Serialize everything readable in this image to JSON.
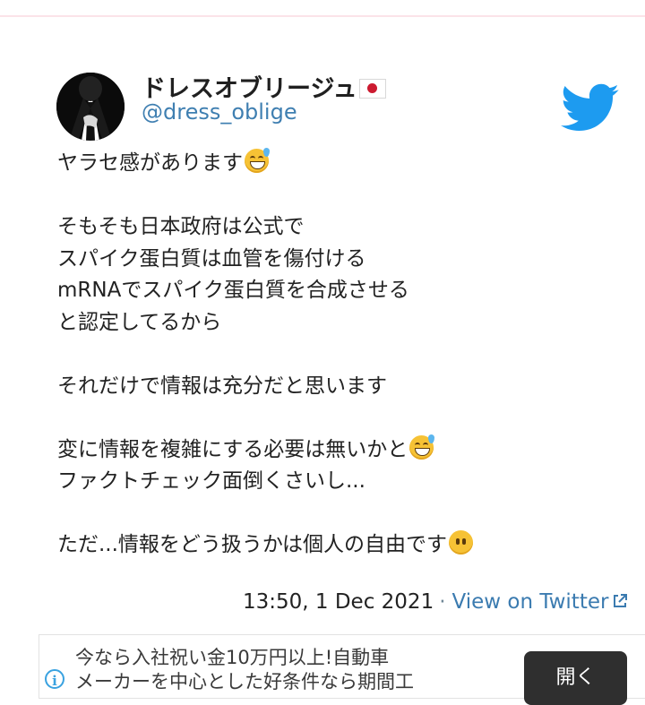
{
  "tweet": {
    "display_name": "ドレスオブリージュ",
    "handle": "@dress_oblige",
    "lines": {
      "l1": "ヤラセ感があります",
      "l2": "そもそも日本政府は公式で",
      "l3": "スパイク蛋白質は血管を傷付ける",
      "l4": "mRNAでスパイク蛋白質を合成させる",
      "l5": "と認定してるから",
      "l6": "それだけで情報は充分だと思います",
      "l7": "変に情報を複雑にする必要は無いかと",
      "l8": "ファクトチェック面倒くさいし...",
      "l9": "ただ...情報をどう扱うかは個人の自由です"
    },
    "timestamp": "13:50, 1 Dec 2021",
    "separator": "·",
    "view_link": "View on Twitter"
  },
  "icons": {
    "brand": "twitter-bird-icon",
    "flag": "japan-flag-icon",
    "emoji_sweat": "grinning-sweat-emoji",
    "emoji_noface": "no-mouth-emoji",
    "external": "external-link-icon",
    "info": "info-icon"
  },
  "colors": {
    "twitter_blue": "#1d9bf0",
    "link": "#3b7bb0",
    "ad_button": "#2f2f2f"
  },
  "ad": {
    "line1": "今なら入社祝い金10万円以上!自動車",
    "line2": "メーカーを中心とした好条件なら期間工",
    "info_glyph": "i",
    "button": "開く"
  }
}
